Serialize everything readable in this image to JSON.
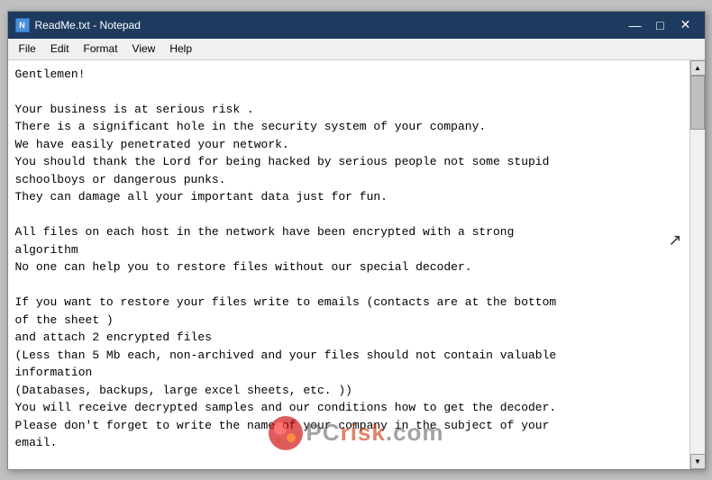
{
  "window": {
    "title": "ReadMe.txt - Notepad",
    "icon_label": "N"
  },
  "title_controls": {
    "minimize": "—",
    "maximize": "□",
    "close": "✕"
  },
  "menu": {
    "items": [
      "File",
      "Edit",
      "Format",
      "View",
      "Help"
    ]
  },
  "content": {
    "text": "Gentlemen!\n\nYour business is at serious risk .\nThere is a significant hole in the security system of your company.\nWe have easily penetrated your network.\nYou should thank the Lord for being hacked by serious people not some stupid\nschoolboys or dangerous punks.\nThey can damage all your important data just for fun.\n\nAll files on each host in the network have been encrypted with a strong\nalgorithm\nNo one can help you to restore files without our special decoder.\n\nIf you want to restore your files write to emails (contacts are at the bottom\nof the sheet )\nand attach 2 encrypted files\n(Less than 5 Mb each, non-archived and your files should not contain valuable\ninformation\n(Databases, backups, large excel sheets, etc. ))\nYou will receive decrypted samples and our conditions how to get the decoder.\nPlease don't forget to write the name of your company in the subject of your\nemail."
  },
  "watermark": {
    "text": "PCrisk.com"
  }
}
